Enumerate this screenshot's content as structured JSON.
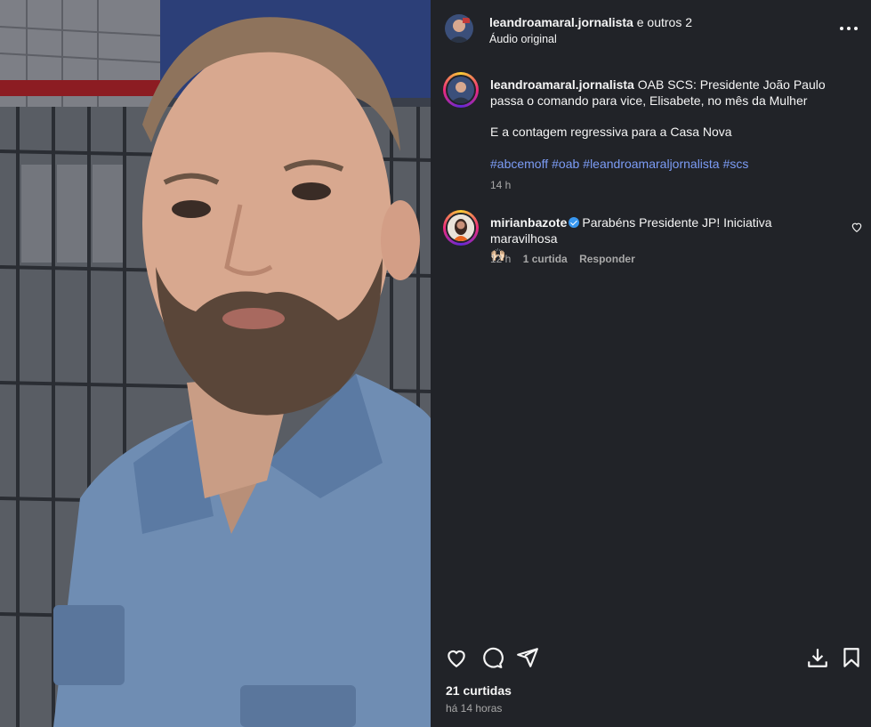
{
  "post": {
    "author": "leandroamaral.jornalista",
    "coauthors": " e outros 2",
    "audio": "Áudio original",
    "caption_user": "leandroamaral.jornalista",
    "caption_text": " OAB SCS: Presidente João Paulo passa o comando para vice, Elisabete, no mês da Mulher",
    "caption_line2": "E a contagem regressiva para a Casa Nova",
    "hashtags": [
      "#abcemoff",
      "#oab",
      "#leandroamaraljornalista",
      "#scs"
    ],
    "caption_time": "14 h",
    "likes": "21 curtidas",
    "posted_ago": "há 14 horas"
  },
  "comment": {
    "user": "mirianbazote",
    "text": "Parabéns Presidente JP! Iniciativa maravilhosa",
    "emoji": "🙌🏻",
    "time": "12 h",
    "likes": "1 curtida",
    "reply": "Responder"
  },
  "icons": {
    "like": "heart-icon",
    "comment": "comment-bubble-icon",
    "share": "paper-plane-icon",
    "download": "download-icon",
    "save": "bookmark-icon",
    "more": "more-dots-icon"
  },
  "colors": {
    "background": "#212328",
    "hashtag": "#7c9cf5",
    "verified": "#3897f0",
    "muted": "#a8a8a8"
  }
}
